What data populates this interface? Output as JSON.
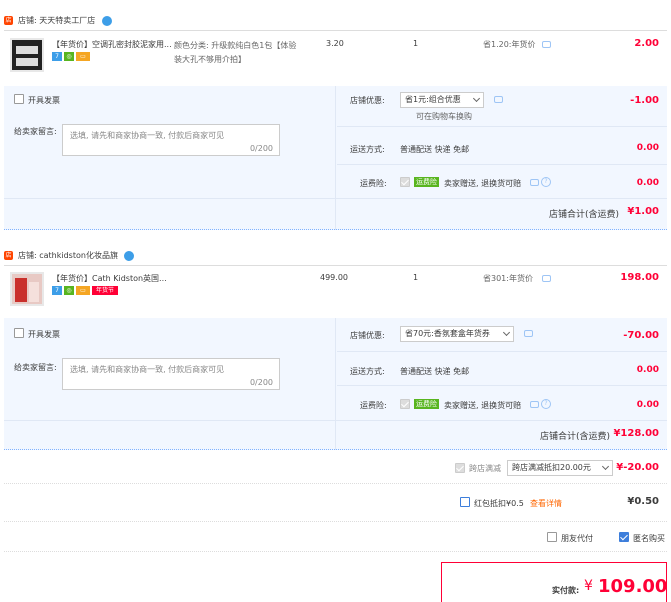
{
  "shop1": {
    "name": "店铺: 天天特卖工厂店",
    "title": "【年货价】空调孔密封胶泥家用...",
    "sku": "颜色分类: 升级款纯白色1包【体验装大孔不够用介拍】",
    "unit_price": "3.20",
    "qty": "1",
    "promo": "省1.20:年货价",
    "subtotal": "2.00",
    "invoice_label": "开具发票",
    "message_label": "给卖家留言:",
    "message_placeholder": "选填, 请先和商家协商一致, 付款后商家可见",
    "message_count": "0/200",
    "coupon_label": "店铺优惠:",
    "coupon_value": "省1元:组合优惠",
    "coupon_note": "可在购物车换购",
    "coupon_amount": "-1.00",
    "ship_label": "运送方式:",
    "ship_value": "普通配送 快递 免邮",
    "ship_amount": "0.00",
    "insure_label": "运费险:",
    "insure_tag": "运费险",
    "insure_value": "卖家赠送, 退换货可赔",
    "insure_amount": "0.00",
    "total_label": "店铺合计(含运费)",
    "total_value": "¥1.00"
  },
  "shop2": {
    "name": "店铺: cathkidston化妆品旗",
    "title": "【年货价】Cath Kidston英国...",
    "tag_year": "年货节",
    "unit_price": "499.00",
    "qty": "1",
    "promo": "省301:年货价",
    "subtotal": "198.00",
    "invoice_label": "开具发票",
    "message_label": "给卖家留言:",
    "message_placeholder": "选填, 请先和商家协商一致, 付款后商家可见",
    "message_count": "0/200",
    "coupon_label": "店铺优惠:",
    "coupon_value": "省70元:香氛套盒年货券",
    "coupon_amount": "-70.00",
    "ship_label": "运送方式:",
    "ship_value": "普通配送 快递 免邮",
    "ship_amount": "0.00",
    "insure_label": "运费险:",
    "insure_tag": "运费险",
    "insure_value": "卖家赠送, 退换货可赔",
    "insure_amount": "0.00",
    "total_label": "店铺合计(含运费)",
    "total_value": "¥128.00"
  },
  "footer": {
    "cross_label": "跨店满减",
    "cross_select": "跨店满减抵扣20.00元",
    "cross_amount": "¥-20.00",
    "redpacket_label": "红包抵扣¥0.5",
    "redpacket_link": "查看详情",
    "redpacket_amount": "¥0.50",
    "friend_pay": "朋友代付",
    "anonymous": "匿名购买",
    "pay_label": "实付款:",
    "pay_currency": "¥",
    "pay_value": "109.00"
  },
  "colors": {
    "accent_red": "#ff0036",
    "panel_blue": "#f2f7ff",
    "link_blue": "#3d9ee8"
  }
}
